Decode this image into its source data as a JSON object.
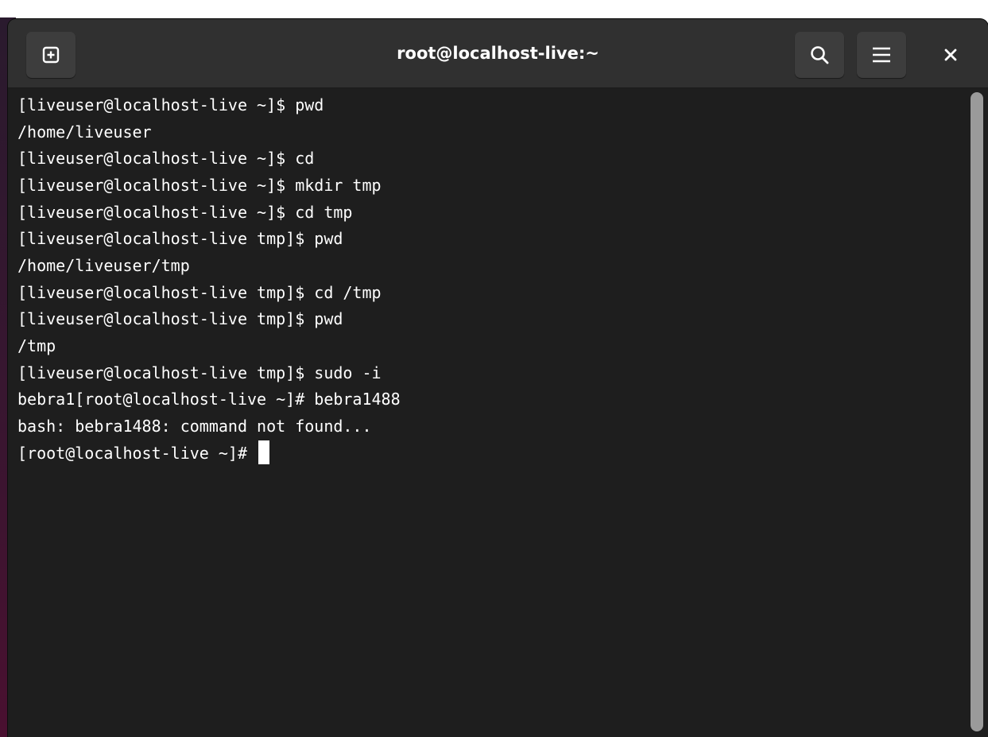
{
  "window": {
    "title": "root@localhost-live:~"
  },
  "header": {
    "new_tab_icon": "new-tab-plus-box-icon",
    "search_icon": "search-icon",
    "menu_icon": "hamburger-menu-icon",
    "close_icon": "close-icon"
  },
  "terminal": {
    "lines": [
      "[liveuser@localhost-live ~]$ pwd",
      "/home/liveuser",
      "[liveuser@localhost-live ~]$ cd",
      "[liveuser@localhost-live ~]$ mkdir tmp",
      "[liveuser@localhost-live ~]$ cd tmp",
      "[liveuser@localhost-live tmp]$ pwd",
      "/home/liveuser/tmp",
      "[liveuser@localhost-live tmp]$ cd /tmp",
      "[liveuser@localhost-live tmp]$ pwd",
      "/tmp",
      "[liveuser@localhost-live tmp]$ sudo -i",
      "bebra1[root@localhost-live ~]# bebra1488",
      "bash: bebra1488: command not found...",
      "[root@localhost-live ~]# "
    ]
  },
  "colors": {
    "terminal_bg": "#1e1e1e",
    "headerbar_bg": "#303030",
    "text": "#ffffff",
    "scrollbar": "#9a9a9a"
  }
}
